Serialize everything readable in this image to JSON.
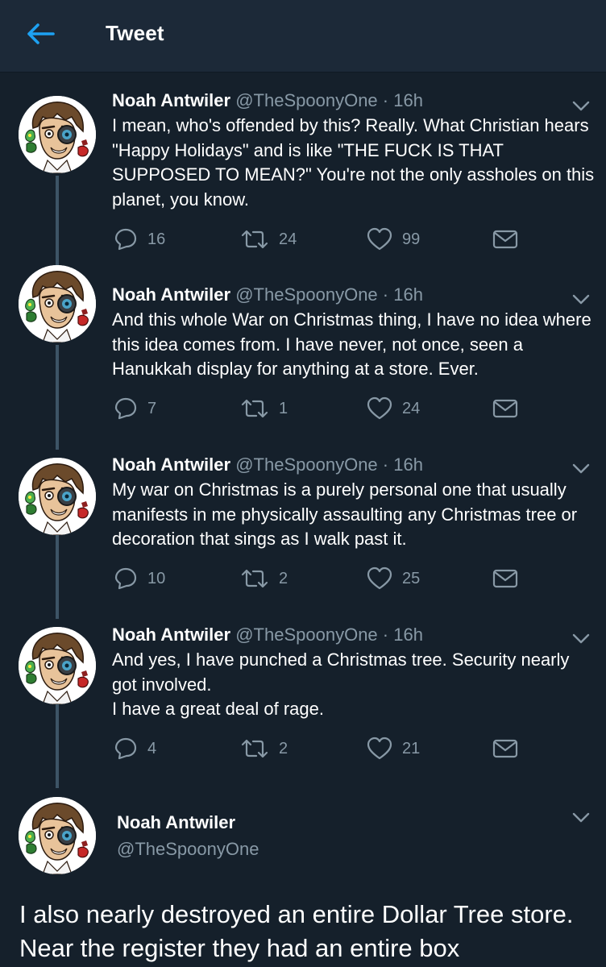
{
  "header": {
    "title": "Tweet"
  },
  "colors": {
    "background": "#15202b",
    "header": "#1c2938",
    "accent": "#1da1f2",
    "muted": "#8899a6",
    "thread_line": "#3d5466"
  },
  "tweets": [
    {
      "name": "Noah Antwiler",
      "handle": "@TheSpoonyOne",
      "time": "· 16h",
      "text": "I mean, who's offended by this? Really. What Christian hears \"Happy Holidays\" and is like \"THE FUCK IS THAT SUPPOSED TO MEAN?\" You're not the only assholes on this planet, you know.",
      "replies": "16",
      "retweets": "24",
      "likes": "99"
    },
    {
      "name": "Noah Antwiler",
      "handle": "@TheSpoonyOne",
      "time": "· 16h",
      "text": "And this whole War on Christmas thing, I have no idea where this idea comes from. I have never, not once, seen a Hanukkah display for anything at a store. Ever.",
      "replies": "7",
      "retweets": "1",
      "likes": "24"
    },
    {
      "name": "Noah Antwiler",
      "handle": "@TheSpoonyOne",
      "time": "· 16h",
      "text": "My war on Christmas is a purely personal one that usually manifests in me physically assaulting any Christmas tree or decoration that sings as I walk past it.",
      "replies": "10",
      "retweets": "2",
      "likes": "25"
    },
    {
      "name": "Noah Antwiler",
      "handle": "@TheSpoonyOne",
      "time": "· 16h",
      "text": "And yes, I have punched a Christmas tree. Security nearly got involved.\nI have a great deal of rage.",
      "replies": "4",
      "retweets": "2",
      "likes": "21"
    }
  ],
  "main_tweet": {
    "name": "Noah Antwiler",
    "handle": "@TheSpoonyOne",
    "text": "I also nearly destroyed an entire Dollar Tree store. Near the register they had an entire box"
  },
  "icons": {
    "back": "arrow-left-icon",
    "menu": "chevron-down-icon",
    "reply": "reply-icon",
    "retweet": "retweet-icon",
    "like": "heart-icon",
    "message": "envelope-icon",
    "avatar": "avatar-illustration"
  }
}
